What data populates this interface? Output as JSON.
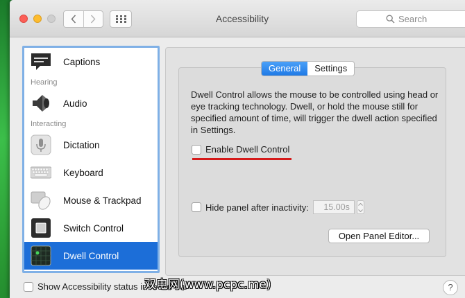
{
  "window": {
    "title": "Accessibility"
  },
  "search": {
    "placeholder": "Search"
  },
  "sidebar": {
    "items": [
      {
        "label": "Captions"
      },
      {
        "heading": "Hearing"
      },
      {
        "label": "Audio"
      },
      {
        "heading": "Interacting"
      },
      {
        "label": "Dictation"
      },
      {
        "label": "Keyboard"
      },
      {
        "label": "Mouse & Trackpad"
      },
      {
        "label": "Switch Control"
      },
      {
        "label": "Dwell Control",
        "selected": true
      }
    ]
  },
  "tabs": [
    {
      "label": "General",
      "active": true
    },
    {
      "label": "Settings",
      "active": false
    }
  ],
  "main": {
    "description": "Dwell Control allows the mouse to be controlled using head or eye tracking technology. Dwell, or hold the mouse still for specified amount of time, will trigger the dwell action specified in Settings.",
    "enable_label": "Enable Dwell Control",
    "enable_checked": false,
    "hide_panel_label": "Hide panel after inactivity:",
    "hide_panel_checked": false,
    "hide_panel_value": "15.00s",
    "open_panel_button": "Open Panel Editor..."
  },
  "footer": {
    "status_label": "Show Accessibility status in menu bar",
    "help": "?"
  },
  "watermark": "双电网(www.pcpc.me)",
  "colors": {
    "accent": "#1c6ed8",
    "annotation": "#d51a1a"
  }
}
